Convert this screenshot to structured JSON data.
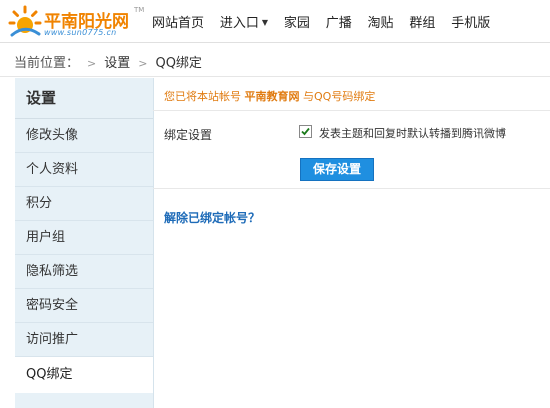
{
  "header": {
    "logo_name": "平南阳光网",
    "logo_tm": "TM",
    "logo_url": "www.sun0775.cn",
    "nav": [
      {
        "label": "网站首页",
        "dropdown": false
      },
      {
        "label": "进入口",
        "dropdown": true
      },
      {
        "label": "家园",
        "dropdown": false
      },
      {
        "label": "广播",
        "dropdown": false
      },
      {
        "label": "淘贴",
        "dropdown": false
      },
      {
        "label": "群组",
        "dropdown": false
      },
      {
        "label": "手机版",
        "dropdown": false
      }
    ]
  },
  "breadcrumb": {
    "prefix": "当前位置：",
    "items": [
      "设置",
      "QQ绑定"
    ]
  },
  "sidebar": {
    "title": "设置",
    "items": [
      {
        "label": "修改头像",
        "active": false
      },
      {
        "label": "个人资料",
        "active": false
      },
      {
        "label": "积分",
        "active": false
      },
      {
        "label": "用户组",
        "active": false
      },
      {
        "label": "隐私筛选",
        "active": false
      },
      {
        "label": "密码安全",
        "active": false
      },
      {
        "label": "访问推广",
        "active": false
      },
      {
        "label": "QQ绑定",
        "active": true
      }
    ]
  },
  "main": {
    "notice_pre": "您已将本站帐号",
    "notice_site": "平南教育网",
    "notice_post": "与QQ号码绑定",
    "bind_label": "绑定设置",
    "checkbox_checked": true,
    "checkbox_label": "发表主题和回复时默认转播到腾讯微博",
    "save_label": "保存设置",
    "unbind_label": "解除已绑定帐号？"
  },
  "colors": {
    "accent_orange": "#e07b10",
    "link_blue": "#1e6bb8",
    "button_blue": "#1f8fe0",
    "sidebar_bg": "#e7f1f7"
  }
}
